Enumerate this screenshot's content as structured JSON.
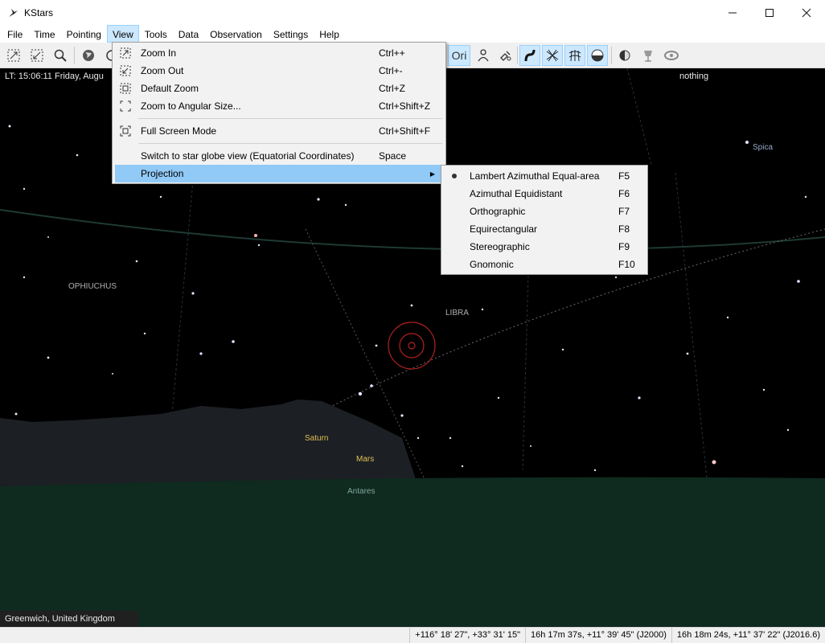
{
  "window": {
    "title": "KStars",
    "minimize": "—",
    "maximize": "☐",
    "close": "✕"
  },
  "menubar": [
    "File",
    "Time",
    "Pointing",
    "View",
    "Tools",
    "Data",
    "Observation",
    "Settings",
    "Help"
  ],
  "toolbar": {
    "icons": [
      "zoom-fit-icon",
      "zoom-original-icon",
      "search-icon",
      "globe-icon",
      "constellation-names-icon",
      "person-icon",
      "satellite-icon",
      "milky-way-icon",
      "equatorial-grid-icon",
      "horizontal-grid-icon",
      "ground-icon",
      "observing-list-icon",
      "telescope-icon",
      "galaxy-icon"
    ],
    "ori_label": "Ori"
  },
  "sky": {
    "lt_readout": "LT: 15:06:11  Friday, Augu",
    "focus_readout": "nothing",
    "location": "Greenwich, United Kingdom",
    "labels": {
      "spica": "Spica",
      "ophiuchus": "OPHIUCHUS",
      "libra": "LIBRA",
      "saturn": "Saturn",
      "mars": "Mars",
      "antares": "Antares"
    }
  },
  "status": {
    "altaz": "+116° 18' 27\", +33° 31' 15\"",
    "j2000": "16h 17m 37s, +11° 39' 45\" (J2000)",
    "jnow": "16h 18m 24s, +11° 37' 22\" (J2016.6)"
  },
  "view_menu": {
    "items": [
      {
        "label": "Zoom In",
        "shortcut": "Ctrl++",
        "icon": "zoom-in-icon"
      },
      {
        "label": "Zoom Out",
        "shortcut": "Ctrl+-",
        "icon": "zoom-out-icon"
      },
      {
        "label": "Default Zoom",
        "shortcut": "Ctrl+Z",
        "icon": "zoom-default-icon"
      },
      {
        "label": "Zoom to Angular Size...",
        "shortcut": "Ctrl+Shift+Z",
        "icon": "zoom-angular-icon"
      },
      {
        "label": "Full Screen Mode",
        "shortcut": "Ctrl+Shift+F",
        "icon": "fullscreen-icon"
      },
      {
        "label": "Switch to star globe view (Equatorial Coordinates)",
        "shortcut": "Space"
      },
      {
        "label": "Projection",
        "shortcut": ""
      }
    ]
  },
  "projection_menu": {
    "selected": "Lambert Azimuthal Equal-area",
    "items": [
      {
        "label": "Lambert Azimuthal Equal-area",
        "shortcut": "F5"
      },
      {
        "label": "Azimuthal Equidistant",
        "shortcut": "F6"
      },
      {
        "label": "Orthographic",
        "shortcut": "F7"
      },
      {
        "label": "Equirectangular",
        "shortcut": "F8"
      },
      {
        "label": "Stereographic",
        "shortcut": "F9"
      },
      {
        "label": "Gnomonic",
        "shortcut": "F10"
      }
    ]
  },
  "colors": {
    "menu_highlight": "#91c9f7",
    "ground": "#0f2a1e",
    "horizon_mist": "#1c1f24",
    "sky": "#000000"
  }
}
